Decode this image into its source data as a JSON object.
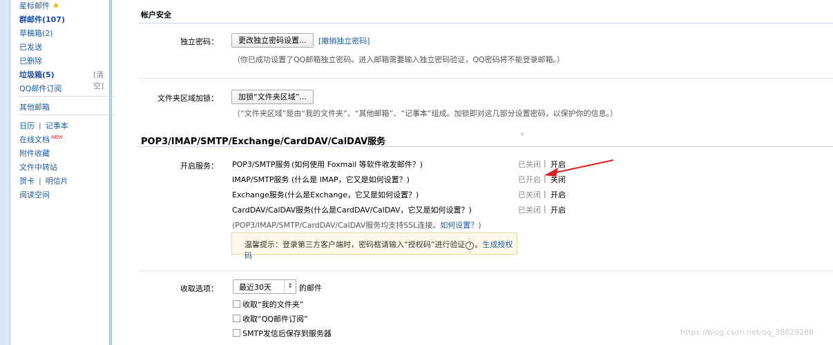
{
  "sidebar": {
    "starred": "星标邮件",
    "group_mail": "群邮件(107)",
    "drafts": "草稿箱(2)",
    "sent": "已发送",
    "deleted": "已删除",
    "spam": "垃圾箱(5)",
    "spam_clear": "[清空]",
    "subscriptions": "QQ邮件订阅",
    "other_mailboxes": "其他邮箱",
    "calendar": "日历",
    "notes": "记事本",
    "online_docs": "在线文档",
    "new_badge": "NEW",
    "attachments": "附件收藏",
    "file_transfer": "文件中转站",
    "cards": "贺卡",
    "postcards": "明信片",
    "reading_space": "阅读空间"
  },
  "account_security": {
    "title": "帐户安全",
    "independent_password_label": "独立密码：",
    "change_password_button": "更改独立密码设置...",
    "revoke_password_link": "[撤销独立密码]",
    "password_hint": "（你已成功设置了QQ邮箱独立密码。进入邮箱需要输入独立密码验证，QQ密码将不能登录邮箱。）",
    "folder_lock_label": "文件夹区域加锁：",
    "folder_lock_button": "加锁“文件夹区域”...",
    "folder_lock_hint": "（“文件夹区域”是由“我的文件夹”、“其他邮箱”、“记事本”组成。加锁即对这几部分设置密码，以保护你的信息。）",
    "dot": "。"
  },
  "services": {
    "title": "POP3/IMAP/SMTP/Exchange/CardDAV/CalDAV服务",
    "enable_label": "开启服务：",
    "rows": [
      {
        "name": "POP3/SMTP服务",
        "help": "(如何使用 Foxmail 等软件收发邮件？)",
        "status": "已关闭",
        "action": "开启"
      },
      {
        "name": "IMAP/SMTP服务",
        "help": "(什么是 IMAP，它又是如何设置？)",
        "status": "已开启",
        "action": "关闭"
      },
      {
        "name": "Exchange服务",
        "help": "(什么是Exchange，它又是如何设置？)",
        "status": "已关闭",
        "action": "开启"
      },
      {
        "name": "CardDAV/CalDAV服务",
        "help": "(什么是CardDAV/CalDAV，它又是如何设置？)",
        "status": "已关闭",
        "action": "开启"
      }
    ],
    "ssl_note": "(POP3/IMAP/SMTP/CardDAV/CalDAV服务均支持SSL连接。",
    "ssl_link": "如何设置？",
    "ssl_close": ")",
    "tip_text": "温馨提示：登录第三方客户端时，密码框请输入“授权码”进行验证",
    "tip_icon": "?",
    "tip_sep": "。",
    "tip_link": "生成授权码",
    "separator": "|"
  },
  "receive": {
    "label": "收取选项：",
    "range_value": "最近30天",
    "range_suffix": "的邮件",
    "options": [
      "收取“我的文件夹”",
      "收取“QQ邮件订阅”",
      "SMTP发信后保存到服务器"
    ]
  },
  "watermark": "https://blog.csdn.net/qq_38829280",
  "colors": {
    "link": "#1a5da6",
    "arrow": "#e02020",
    "tip_background": "#fffae7"
  },
  "icons": [
    "star-icon",
    "select-arrows-icon",
    "help-circle-icon",
    "red-arrow-annotation"
  ]
}
